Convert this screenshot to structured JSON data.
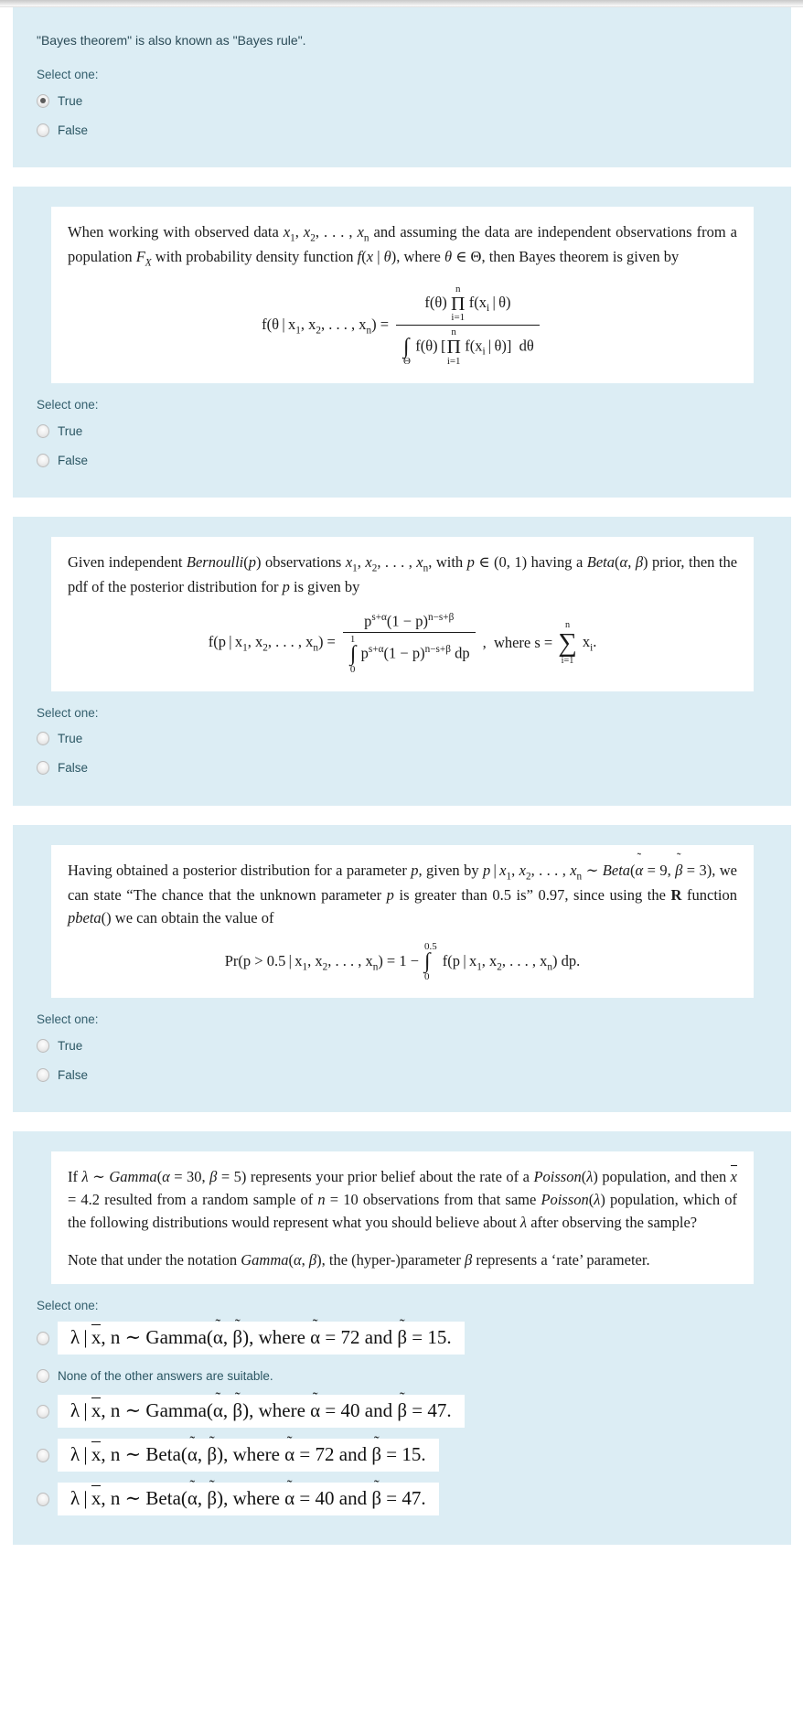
{
  "page": {
    "background": "#ffffff",
    "panel_color": "#dcedf4",
    "card_color": "#ffffff",
    "text_color": "#2b5663",
    "math_color": "#111111"
  },
  "common": {
    "select_one": "Select one:",
    "true_label": "True",
    "false_label": "False"
  },
  "questions": [
    {
      "id": "q1",
      "type": "truefalse",
      "stem_plain": "\"Bayes theorem\" is also known as \"Bayes rule\".",
      "select_one": "Select one:",
      "options": [
        {
          "label": "True",
          "checked": true
        },
        {
          "label": "False",
          "checked": false
        }
      ]
    },
    {
      "id": "q2",
      "type": "truefalse",
      "stem_tex_line1_a": "When working with observed data ",
      "stem_tex_x1": "x",
      "stem_tex_sub1": "1",
      "stem_tex_x2": "x",
      "stem_tex_sub2": "2",
      "stem_tex_dots": ", . . . ,",
      "stem_tex_xn": "x",
      "stem_tex_subn": "n",
      "stem_tex_line1_b": " and assuming the data are independent observations from a population ",
      "stem_F": "F",
      "stem_FX": "X",
      "stem_tex_line1_c": " with probability density function ",
      "stem_fxtheta": "f(x | θ)",
      "stem_tex_line1_d": ", where ",
      "stem_thetain": "θ ∈ Θ",
      "stem_tex_line1_e": ", then Bayes theorem is given by",
      "equation": {
        "lhs": "f(θ | x₁, x₂, . . . , xₙ) =",
        "numerator": "f(θ) ∏ⁿᵢ₌₁ f(xᵢ | θ)",
        "denominator": "∫Θ f(θ) [∏ⁿᵢ₌₁ f(xᵢ | θ)] dθ"
      },
      "select_one": "Select one:",
      "options": [
        {
          "label": "True",
          "checked": false
        },
        {
          "label": "False",
          "checked": false
        }
      ]
    },
    {
      "id": "q3",
      "type": "truefalse",
      "stem_a": "Given independent ",
      "stem_bernoulli": "Bernoulli(p)",
      "stem_b": " observations ",
      "stem_obs": "x₁, x₂, . . . , xₙ,",
      "stem_c": " with ",
      "stem_pin": "p ∈ (0, 1)",
      "stem_d": " having a ",
      "stem_beta": "Beta(α, β)",
      "stem_e": " prior, then the pdf of the posterior distribution for ",
      "stem_p": "p",
      "stem_f": " is given by",
      "equation": {
        "lhs": "f(p | x₁, x₂, . . . , xₙ) =",
        "numerator": "p^{s+α}(1 − p)^{n−s+β}",
        "denominator": "∫₀¹ p^{s+α}(1 − p)^{n−s+β} dp",
        "rhs": "where s = ∑ⁿᵢ₌₁ xᵢ."
      },
      "select_one": "Select one:",
      "options": [
        {
          "label": "True",
          "checked": false
        },
        {
          "label": "False",
          "checked": false
        }
      ]
    },
    {
      "id": "q4",
      "type": "truefalse",
      "stem_a": "Having obtained a posterior distribution for a parameter ",
      "stem_p": "p",
      "stem_b": ", given by ",
      "stem_given": "p | x₁, x₂, . . . , xₙ ∼",
      "stem_beta_params": "Beta(α̃ = 9, β̃ = 3)",
      "stem_c": ", we can state “The chance that the unknown parameter ",
      "stem_d": " is greater than 0.5 is” 0.97, since using the ",
      "stem_R": "R",
      "stem_e": " function ",
      "stem_pbeta": "pbeta()",
      "stem_f": " we can obtain the value of",
      "equation": {
        "lhs": "Pr(p > 0.5 | x₁, x₂, . . . , xₙ) = 1 −",
        "integral_upper": "0.5",
        "integral_lower": "0",
        "integrand": "f(p | x₁, x₂, . . . , xₙ) dp."
      },
      "select_one": "Select one:",
      "options": [
        {
          "label": "True",
          "checked": false
        },
        {
          "label": "False",
          "checked": false
        }
      ]
    },
    {
      "id": "q5",
      "type": "multichoice",
      "stem_a": "If ",
      "stem_lambda": "λ ∼ ",
      "stem_gamma": "Gamma(α = 30, β = 5)",
      "stem_b": " represents your prior belief about the rate of a ",
      "stem_poisson": "Poisson(λ)",
      "stem_c": " population, and then ",
      "stem_xbar": "x̄ = 4.2",
      "stem_d": " resulted from a random sample of ",
      "stem_n": "n = 10",
      "stem_e": " observations from that same ",
      "stem_f": " population, which of the following distributions would represent what you should believe about ",
      "stem_lam2": "λ",
      "stem_g": " after observing the sample?",
      "note_a": "Note that under the notation ",
      "note_gamma": "Gamma(α, β)",
      "note_b": ", the (hyper-)parameter ",
      "note_beta": "β",
      "note_c": " represents a ‘rate’ parameter.",
      "select_one": "Select one:",
      "options": [
        {
          "kind": "math",
          "checked": false,
          "text": "λ | x̄, n ∼ Gamma(α̃, β̃), where α̃ = 72 and β̃ = 15.",
          "dist": "Gamma",
          "alpha": "72",
          "beta": "15"
        },
        {
          "kind": "plain",
          "checked": false,
          "text": "None of the other answers are suitable."
        },
        {
          "kind": "math",
          "checked": false,
          "text": "λ | x̄, n ∼ Gamma(α̃, β̃), where α̃ = 40 and β̃ = 47.",
          "dist": "Gamma",
          "alpha": "40",
          "beta": "47"
        },
        {
          "kind": "math",
          "checked": false,
          "text": "λ | x̄, n ∼ Beta(α̃, β̃), where α̃ = 72 and β̃ = 15.",
          "dist": "Beta",
          "alpha": "72",
          "beta": "15"
        },
        {
          "kind": "math",
          "checked": false,
          "text": "λ | x̄, n ∼ Beta(α̃, β̃), where α̃ = 40 and β̃ = 47.",
          "dist": "Beta",
          "alpha": "40",
          "beta": "47"
        }
      ]
    }
  ]
}
